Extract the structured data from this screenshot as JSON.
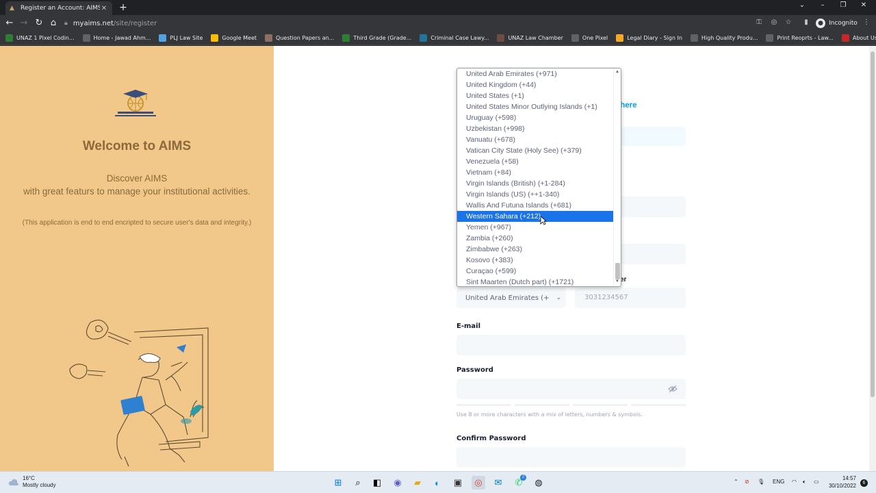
{
  "browser": {
    "tab_title": "Register an Account: AIMS Mode",
    "close_glyph": "✕",
    "new_tab_glyph": "+",
    "url_host": "myaims.net",
    "url_path": "/site/register",
    "profile_label": "Incognito",
    "bookmarks": [
      {
        "label": "UNAZ 1 Pixel Codin...",
        "color": "#2e7d32"
      },
      {
        "label": "Home - Jawad Ahm...",
        "color": "#5f6368"
      },
      {
        "label": "PLJ Law Site",
        "color": "#4fa3e0"
      },
      {
        "label": "Google Meet",
        "color": "#fbbc04"
      },
      {
        "label": "Question Papers an...",
        "color": "#8d6e63"
      },
      {
        "label": "Third Grade (Grade...",
        "color": "#2e7d32"
      },
      {
        "label": "Criminal Case Lawy...",
        "color": "#21759b"
      },
      {
        "label": "UNAZ Law Chamber",
        "color": "#6d4c41"
      },
      {
        "label": "One Pixel",
        "color": "#5f6368"
      },
      {
        "label": "Legal Diary - Sign In",
        "color": "#f9a825"
      },
      {
        "label": "High Quality Produ...",
        "color": "#616161"
      },
      {
        "label": "Print Reoprts - Law...",
        "color": "#5f6368"
      },
      {
        "label": "About Us",
        "color": "#c62828"
      }
    ]
  },
  "left": {
    "welcome": "Welcome to AIMS",
    "discover_line1": "Discover AIMS",
    "discover_line2": "with great featurs to manage your institutional activities.",
    "note": "(This application is end to end encripted to secure user's data and integrity.)"
  },
  "form": {
    "title_fragment": "t",
    "link_fragment": "n here",
    "phone_label_fragment": "er",
    "country_code_value": "United Arab Emirates (+",
    "phone_placeholder": "3031234567",
    "email_label": "E-mail",
    "password_label": "Password",
    "password_hint": "Use 8 or more characters with a mix of letters, numbers & symbols.",
    "confirm_password_label": "Confirm Password"
  },
  "dropdown": {
    "options": [
      "United Arab Emirates (+971)",
      "United Kingdom (+44)",
      "United States (+1)",
      "United States Minor Outlying Islands (+1)",
      "Uruguay (+598)",
      "Uzbekistan (+998)",
      "Vanuatu (+678)",
      "Vatican City State (Holy See) (+379)",
      "Venezuela (+58)",
      "Vietnam (+84)",
      "Virgin Islands (British) (+1-284)",
      "Virgin Islands (US) (++1-340)",
      "Wallis And Futuna Islands (+681)",
      "Western Sahara (+212)",
      "Yemen (+967)",
      "Zambia (+260)",
      "Zimbabwe (+263)",
      "Kosovo (+383)",
      "Curaçao (+599)",
      "Sint Maarten (Dutch part) (+1721)"
    ],
    "highlighted": "Western Sahara (+212)"
  },
  "taskbar": {
    "temperature": "16°C",
    "weather": "Mostly cloudy",
    "language": "ENG",
    "time": "14:57",
    "date": "30/10/2022",
    "notification_count": "6",
    "badge_count": "2"
  },
  "colors": {
    "accent": "#1a73e8",
    "left_panel": "#f1c88a",
    "brand_text": "#8a6a3a"
  }
}
